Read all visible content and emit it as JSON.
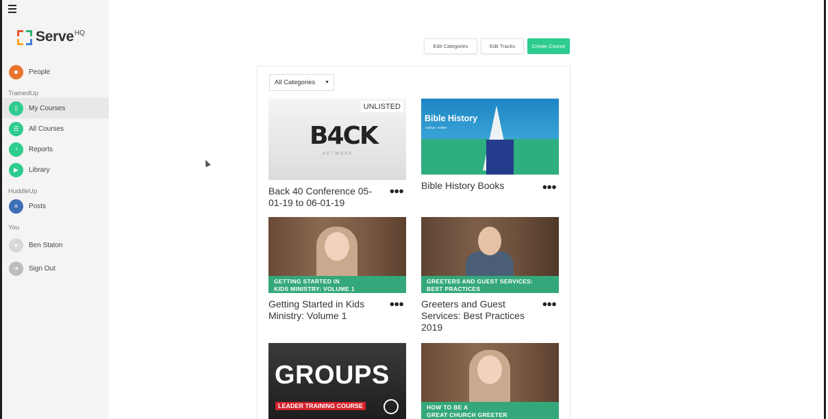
{
  "app": {
    "logo_text": "Serve",
    "logo_sup": "HQ"
  },
  "sidebar": {
    "items": [
      {
        "label": "People",
        "icon": "people-icon",
        "color": "#e8732b"
      },
      {
        "label": "My Courses",
        "icon": "book-icon",
        "color": "#2ecc8e",
        "active": true
      },
      {
        "label": "All Courses",
        "icon": "courses-icon",
        "color": "#2ecc8e"
      },
      {
        "label": "Reports",
        "icon": "pie-chart-icon",
        "color": "#2ecc8e"
      },
      {
        "label": "Library",
        "icon": "video-icon",
        "color": "#2ecc8e"
      },
      {
        "label": "Posts",
        "icon": "list-icon",
        "color": "#3d6fb6"
      },
      {
        "label": "Ben Staton",
        "icon": "avatar-icon",
        "color": "#cfcfcf"
      },
      {
        "label": "Sign Out",
        "icon": "sign-out-icon",
        "color": "#bdbdbd"
      }
    ],
    "sections": {
      "trainedup": "TrainedUp",
      "huddleup": "HuddleUp",
      "you": "You"
    }
  },
  "toolbar": {
    "edit_categories": "Edit Categories",
    "edit_tracks": "Edit Tracks",
    "create_course": "Create Course"
  },
  "filter": {
    "selected": "All Categories"
  },
  "courses": [
    {
      "title": "Back 40 Conference 05-01-19 to 06-01-19",
      "badge": "UNLISTED",
      "thumb_text": "B4CK",
      "thumb_sub": "NETWORK"
    },
    {
      "title": "Bible History Books",
      "thumb_text": "Bible History",
      "thumb_sub": "Joshua - Esther"
    },
    {
      "title": "Getting Started in Kids Ministry: Volume 1",
      "banner": [
        "GETTING STARTED IN",
        "KIDS MINISTRY: VOLUME 1"
      ]
    },
    {
      "title": "Greeters and Guest Services: Best Practices 2019",
      "banner": [
        "GREETERS AND GUEST SERVICES:",
        "BEST PRACTICES"
      ]
    },
    {
      "title": "",
      "thumb_text": "GROUPS",
      "thumb_sub": "LEADER TRAINING COURSE"
    },
    {
      "title": "",
      "banner": [
        "HOW TO BE A",
        "GREAT CHURCH GREETER"
      ]
    }
  ],
  "colors": {
    "accent": "#2ecc8e",
    "banner_green": "#34a87a"
  }
}
